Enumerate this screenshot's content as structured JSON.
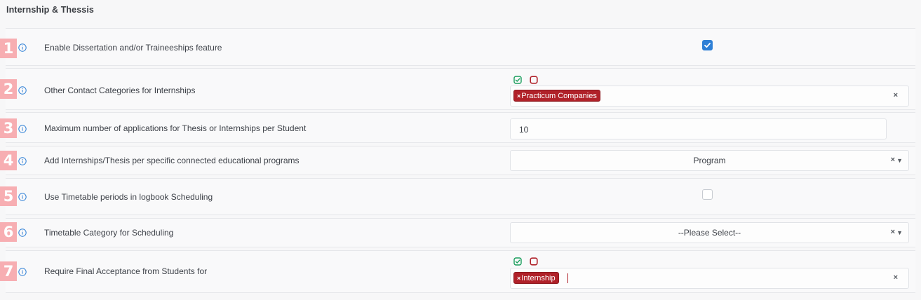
{
  "section": {
    "title": "Internship & Thessis"
  },
  "rows": [
    {
      "number": "1",
      "label": "Enable Dissertation and/or Traineeships feature",
      "control": "checkbox",
      "checked": true
    },
    {
      "number": "2",
      "label": "Other Contact Categories for Internships",
      "control": "multiselect",
      "tags": [
        "Practicum Companies"
      ]
    },
    {
      "number": "3",
      "label": "Maximum number of applications for Thesis or Internships per Student",
      "control": "input",
      "value": "10"
    },
    {
      "number": "4",
      "label": "Add Internships/Thesis per specific connected educational programs",
      "control": "select",
      "selected": "Program"
    },
    {
      "number": "5",
      "label": "Use Timetable periods in logbook Scheduling",
      "control": "checkbox",
      "checked": false
    },
    {
      "number": "6",
      "label": "Timetable Category for Scheduling",
      "control": "select",
      "selected": "--Please Select--"
    },
    {
      "number": "7",
      "label": "Require Final Acceptance from Students for",
      "control": "multiselect",
      "tags": [
        "Internship"
      ]
    }
  ],
  "symbols": {
    "tag_remove": "×",
    "clear": "×",
    "dropdown": "▼"
  },
  "icons": {
    "info": "info-circle-icon",
    "select_all": "check-square-icon",
    "deselect_all": "empty-square-icon",
    "checkmark": "checkmark-icon"
  },
  "colors": {
    "badge": "#f7aeb2",
    "checkbox_checked": "#2f80d6",
    "tag": "#b02129",
    "select_all_icon": "#1a9e5c",
    "deselect_all_icon": "#b02129",
    "info_icon": "#2f80d6"
  }
}
